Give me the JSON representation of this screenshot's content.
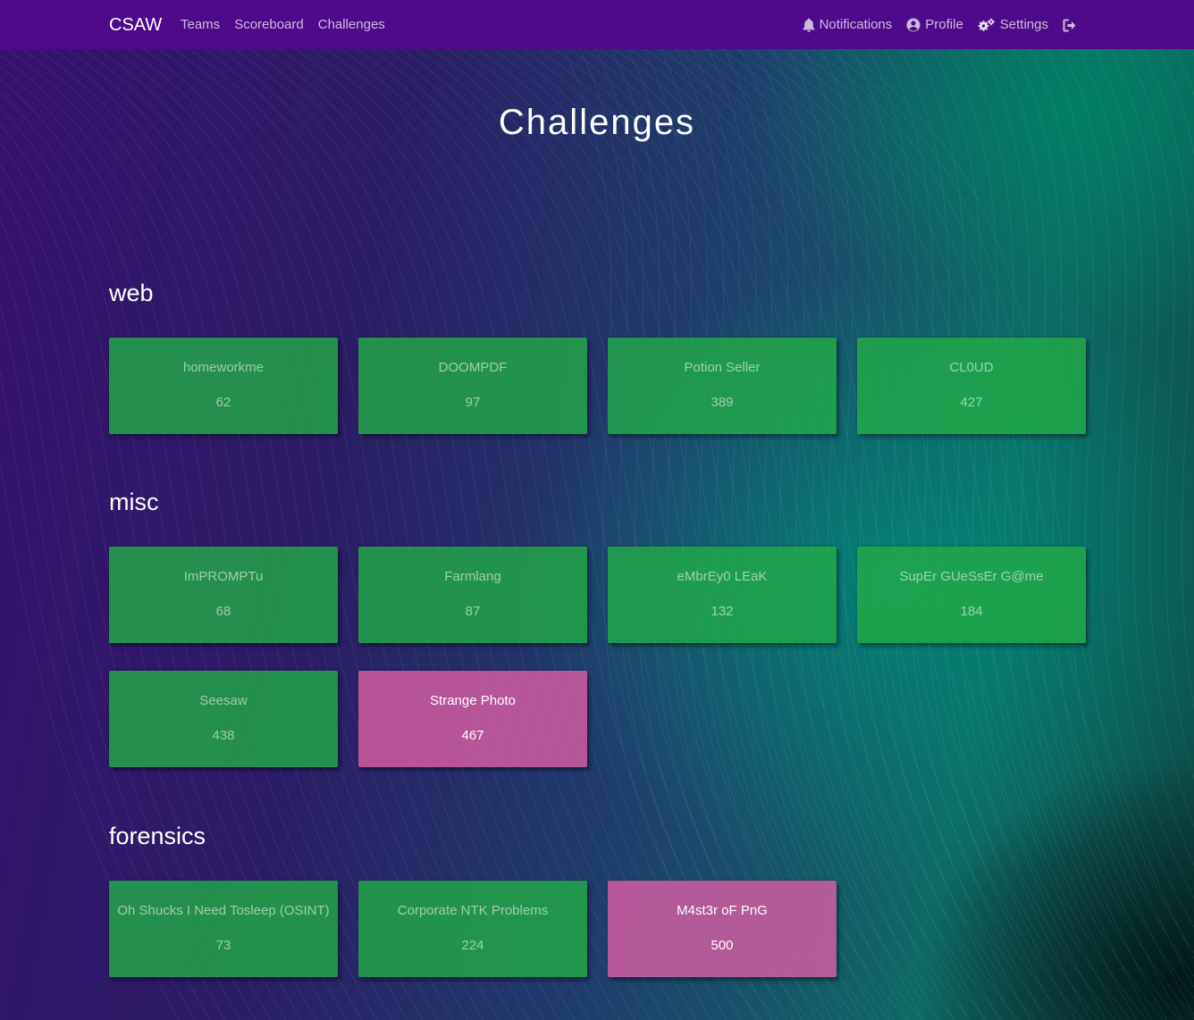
{
  "navbar": {
    "brand": "CSAW",
    "links": [
      "Teams",
      "Scoreboard",
      "Challenges"
    ],
    "notifications": "Notifications",
    "profile": "Profile",
    "settings": "Settings",
    "icons": {
      "notifications": "bell-icon",
      "profile": "user-circle-icon",
      "settings": "gears-icon",
      "logout": "sign-out-icon"
    }
  },
  "page": {
    "title": "Challenges"
  },
  "colors": {
    "navbar": "#4d0a8a",
    "unsolved_card": "#22aa48",
    "solved_card": "#d05ca0"
  },
  "categories": [
    {
      "name": "web",
      "challenges": [
        {
          "name": "homeworkme",
          "points": "62",
          "solved": false
        },
        {
          "name": "DOOMPDF",
          "points": "97",
          "solved": false
        },
        {
          "name": "Potion Seller",
          "points": "389",
          "solved": false
        },
        {
          "name": "CL0UD",
          "points": "427",
          "solved": false
        }
      ]
    },
    {
      "name": "misc",
      "challenges": [
        {
          "name": "ImPROMPTu",
          "points": "68",
          "solved": false
        },
        {
          "name": "Farmlang",
          "points": "87",
          "solved": false
        },
        {
          "name": "eMbrEy0 LEaK",
          "points": "132",
          "solved": false
        },
        {
          "name": "SupEr GUeSsEr G@me",
          "points": "184",
          "solved": false
        },
        {
          "name": "Seesaw",
          "points": "438",
          "solved": false
        },
        {
          "name": "Strange Photo",
          "points": "467",
          "solved": true
        }
      ]
    },
    {
      "name": "forensics",
      "challenges": [
        {
          "name": "Oh Shucks I Need Tosleep (OSINT)",
          "points": "73",
          "solved": false
        },
        {
          "name": "Corporate NTK Problems",
          "points": "224",
          "solved": false
        },
        {
          "name": "M4st3r oF PnG",
          "points": "500",
          "solved": true
        }
      ]
    }
  ]
}
